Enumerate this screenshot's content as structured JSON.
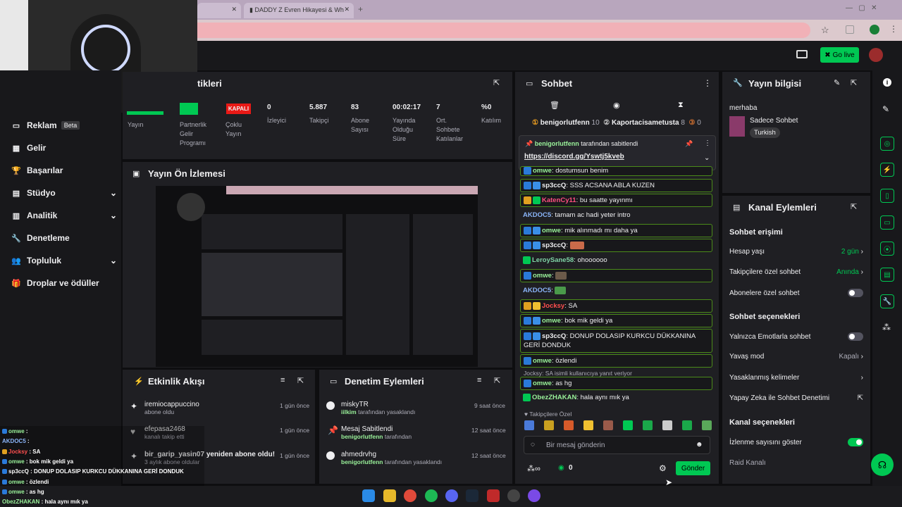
{
  "browser": {
    "tabs": [
      "DADDY Z Evren Hikayesi & Wh"
    ]
  },
  "header": {
    "go_live": "Go live"
  },
  "sidebar": {
    "items": [
      {
        "label": "Reklam",
        "badge": "Beta"
      },
      {
        "label": "Gelir"
      },
      {
        "label": "Başarılar"
      },
      {
        "label": "Stüdyo"
      },
      {
        "label": "Analitik"
      },
      {
        "label": "Denetleme"
      },
      {
        "label": "Topluluk"
      },
      {
        "label": "Droplar ve ödüller"
      }
    ]
  },
  "stats": {
    "title": "tikleri",
    "badge": "KAPALI",
    "items": [
      {
        "value": "",
        "label": "Yayın"
      },
      {
        "value": "",
        "label": "Partnerlik Gelir Programı"
      },
      {
        "value": "",
        "label": "Çoklu Yayın"
      },
      {
        "value": "0",
        "label": "İzleyici"
      },
      {
        "value": "5.887",
        "label": "Takipçi"
      },
      {
        "value": "83",
        "label": "Abone Sayısı"
      },
      {
        "value": "00:02:17",
        "label": "Yayında Olduğu Süre"
      },
      {
        "value": "7",
        "label": "Ort. Sohbete Katılanlar"
      },
      {
        "value": "%0",
        "label": "Katılım"
      }
    ]
  },
  "preview": {
    "title": "Yayın Ön İzlemesi"
  },
  "activity": {
    "title": "Etkinlik Akışı",
    "items": [
      {
        "name": "iremiocappuccino",
        "sub": "abone oldu",
        "time": "1 gün önce"
      },
      {
        "name": "efepasa2468",
        "sub": "kanalı takip etti",
        "time": "1 gün önce"
      },
      {
        "name": "bir_garip_yasin07 yeniden abone oldu!",
        "sub": "3 aylık abone oldular",
        "time": "1 gün önce"
      }
    ]
  },
  "moderation": {
    "title": "Denetim Eylemleri",
    "items": [
      {
        "name": "miskyTR",
        "sub1": "iilkim",
        "sub2": " tarafından yasaklandı",
        "time": "9 saat önce"
      },
      {
        "name": "Mesaj Sabitlendi",
        "sub1": "benigorlutfenn",
        "sub2": " tarafından",
        "time": "12 saat önce"
      },
      {
        "name": "ahmedrvhg",
        "sub1": "benigorlutfenn",
        "sub2": " tarafından yasaklandı",
        "time": "12 saat önce"
      }
    ]
  },
  "chat": {
    "title": "Sohbet",
    "top": {
      "user1": "benigorlutfenn",
      "n1": "10",
      "user2": "Kaportacisametusta",
      "n2": "8",
      "n3": "0"
    },
    "pinned": {
      "by": "benigorlutfenn",
      "suffix": " tarafından sabitlendi",
      "link": "https://discord.gg/Yswtj5kveb"
    },
    "messages": [
      {
        "user": "omwe",
        "text": "dostumsun benim",
        "color": "#9af29a"
      },
      {
        "user": "sp3ccQ",
        "text": "SSS ACSANA ABLA KUZEN",
        "color": "#ffffff"
      },
      {
        "user": "KatenCy11",
        "text": "bu saatte yayınmı",
        "color": "#ff4f81"
      },
      {
        "user": "AKDOC5",
        "text": "tamam ac hadi yeter intro",
        "color": "#8ab4f8"
      },
      {
        "user": "omwe",
        "text": "mik alınmadı mı daha ya",
        "color": "#9af29a"
      },
      {
        "user": "sp3ccQ",
        "text": "",
        "color": "#ffffff"
      },
      {
        "user": "LeroySane58",
        "text": "ohoooooo",
        "color": "#7fd3a5"
      },
      {
        "user": "omwe",
        "text": "",
        "color": "#9af29a"
      },
      {
        "user": "AKDOC5",
        "text": "",
        "color": "#8ab4f8"
      },
      {
        "user": "Jocksy",
        "text": "SA",
        "color": "#ff4f4f"
      },
      {
        "user": "omwe",
        "text": "bok mik geldi ya",
        "color": "#9af29a"
      },
      {
        "user": "sp3ccQ",
        "text": "DONUP DOLASIP KURKCU DÜKKANINA GERİ DONDUK",
        "color": "#ffffff"
      },
      {
        "user": "omwe",
        "text": "özlendi",
        "color": "#9af29a"
      },
      {
        "user": "omwe",
        "text": "as hg",
        "color": "#9af29a"
      },
      {
        "user": "ObezZHAKAN",
        "text": "hala aynı mık ya",
        "color": "#9af29a"
      }
    ],
    "reply": "Jocksy: SA isimli kullanıcıya yanıt veriyor",
    "follower_only": "Takipçilere Özel",
    "placeholder": "Bir mesaj gönderin",
    "points": "0",
    "send": "Gönder"
  },
  "info": {
    "title": "Yayın bilgisi",
    "stream_title": "merhaba",
    "category": "Sadece Sohbet",
    "tag": "Turkish"
  },
  "actions": {
    "title": "Kanal Eylemleri",
    "sec1": "Sohbet erişimi",
    "acc_age": "Hesap yaşı",
    "acc_age_val": "2 gün",
    "follower_chat": "Takipçilere özel sohbet",
    "follower_chat_val": "Anında",
    "sub_chat": "Abonelere özel sohbet",
    "sec2": "Sohbet seçenekleri",
    "emote_only": "Yalnızca Emotlarla sohbet",
    "slow": "Yavaş mod",
    "slow_val": "Kapalı",
    "banned_words": "Yasaklanmış kelimeler",
    "ai": "Yapay Zeka ile Sohbet Denetimi",
    "sec3": "Kanal seçenekleri",
    "show_views": "İzlenme sayısını göster",
    "raid": "Raid Kanalı"
  },
  "overlay": [
    {
      "user": "omwe",
      "text": "",
      "color": "#9af29a"
    },
    {
      "user": "AKDOC5",
      "text": "",
      "color": "#8ab4f8"
    },
    {
      "user": "Jocksy",
      "text": "SA",
      "color": "#ff4f4f"
    },
    {
      "user": "omwe",
      "text": "bok mik geldi ya",
      "color": "#9af29a"
    },
    {
      "user": "sp3ccQ",
      "text": "DONUP DOLASIP KURKCU DÜKKANINA GERİ DONDUK",
      "color": "#ffffff"
    },
    {
      "user": "omwe",
      "text": "özlendi",
      "color": "#9af29a"
    },
    {
      "user": "omwe",
      "text": "as hg",
      "color": "#9af29a"
    },
    {
      "user": "ObezZHAKAN",
      "text": "hala aynı mık ya",
      "color": "#9af29a"
    }
  ]
}
